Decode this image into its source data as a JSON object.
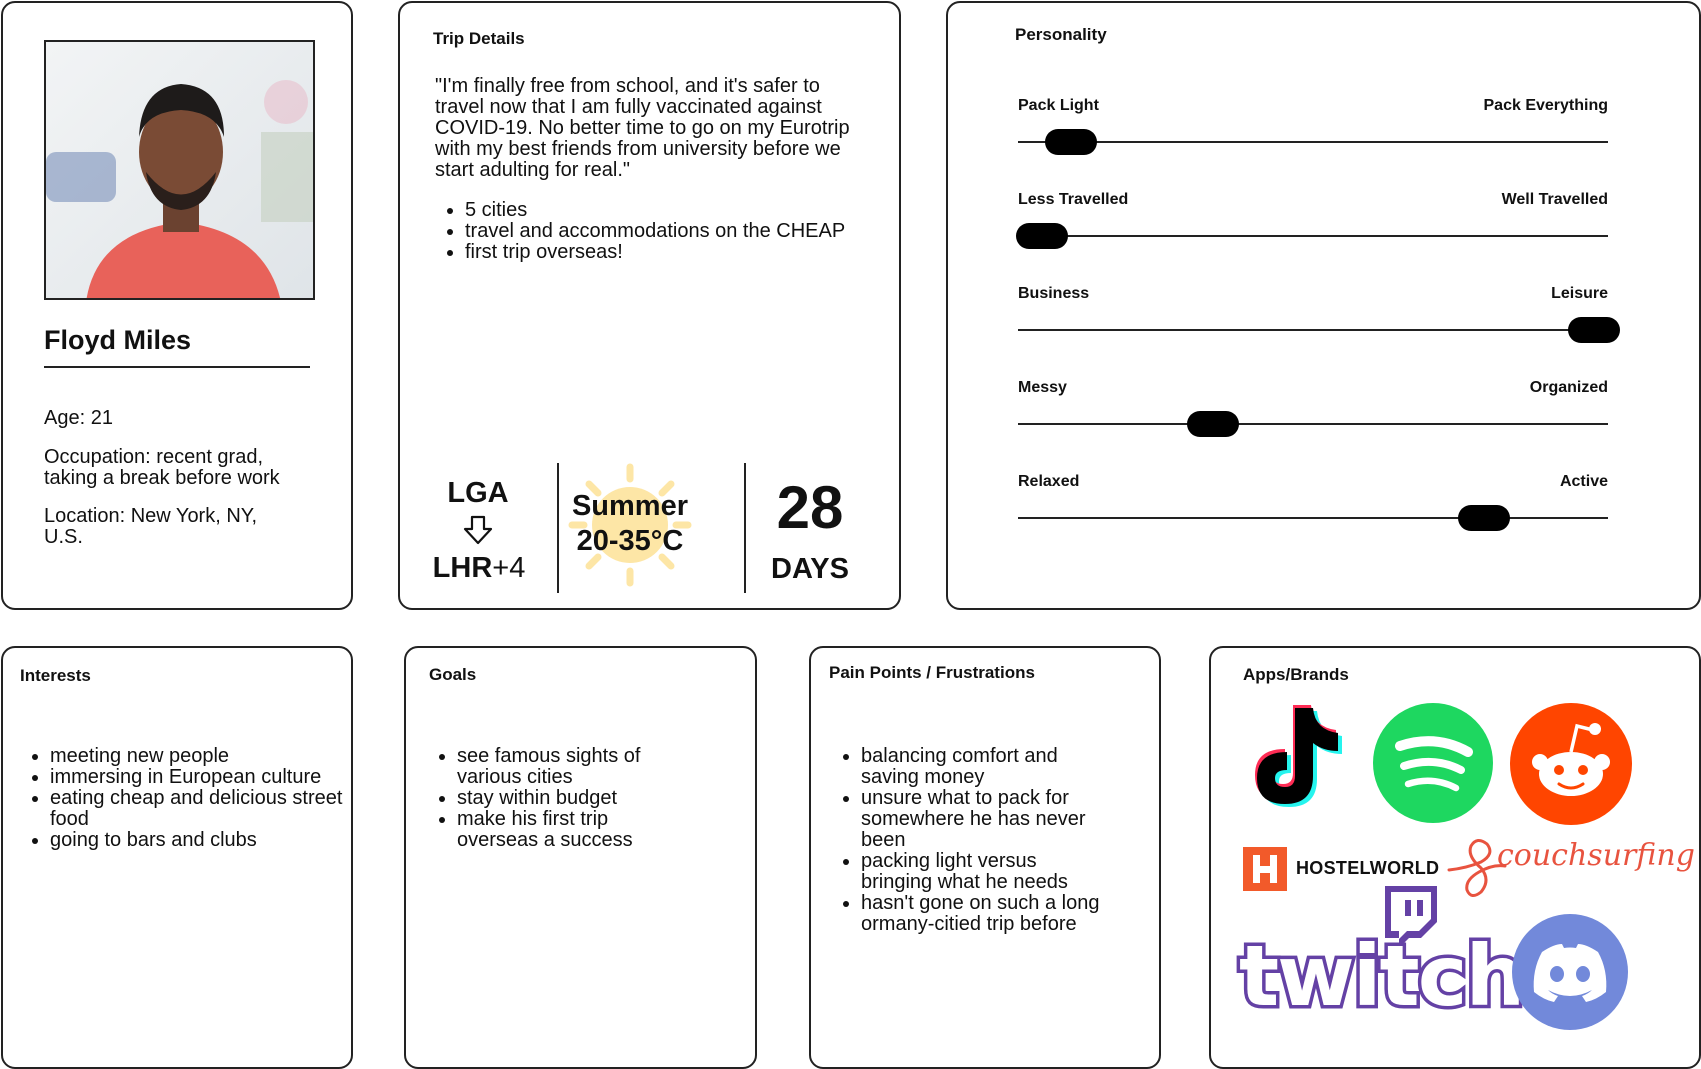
{
  "profile": {
    "name": "Floyd Miles",
    "age": "Age: 21",
    "occupation": "Occupation: recent grad, taking a break before work",
    "location": "Location: New York, NY, U.S."
  },
  "trip": {
    "title": "Trip Details",
    "quote": "\"I'm finally free from school, and it's safer to travel now that I am fully vaccinated against COVID-19. No better time to go on my Eurotrip with my best friends from university before we start adulting for real.\"",
    "bullets": [
      "5 cities",
      "travel and accommodations on the CHEAP",
      "first trip overseas!"
    ],
    "from": "LGA",
    "to": "LHR",
    "tz_offset": "+4",
    "season": "Summer",
    "temp": "20-35°C",
    "days_number": "28",
    "days_label": "DAYS"
  },
  "personality": {
    "title": "Personality",
    "sliders": [
      {
        "left": "Pack Light",
        "right": "Pack Everything",
        "value": 0.09
      },
      {
        "left": "Less Travelled",
        "right": "Well Travelled",
        "value": 0.04
      },
      {
        "left": "Business",
        "right": "Leisure",
        "value": 0.98
      },
      {
        "left": "Messy",
        "right": "Organized",
        "value": 0.33
      },
      {
        "left": "Relaxed",
        "right": "Active",
        "value": 0.79
      }
    ]
  },
  "interests": {
    "title": "Interests",
    "items": [
      "meeting new people",
      "immersing in European culture",
      "eating cheap and delicious street food",
      "going to bars and clubs"
    ]
  },
  "goals": {
    "title": "Goals",
    "items": [
      "see famous sights of various cities",
      "stay within budget",
      "make his first trip overseas a success"
    ]
  },
  "pain_points": {
    "title": "Pain Points / Frustrations",
    "items": [
      "balancing comfort and saving money",
      "unsure what to pack for somewhere he has never been",
      "packing light versus bringing what he needs",
      "hasn't gone on such a long ormany-citied trip before"
    ]
  },
  "apps": {
    "title": "Apps/Brands",
    "hostelworld": "HOSTELWORLD",
    "couchsurfing": "couchsurfing",
    "twitch": "twitch",
    "icons": [
      "tiktok-icon",
      "spotify-icon",
      "reddit-icon",
      "hostelworld-logo",
      "couchsurfing-logo",
      "twitch-logo",
      "discord-icon"
    ],
    "colors": {
      "spotify": "#1ed760",
      "reddit": "#ff4500",
      "hostelworld": "#f25a2a",
      "couchsurfing": "#e8533f",
      "twitch": "#6441a5",
      "discord": "#7289da"
    }
  }
}
